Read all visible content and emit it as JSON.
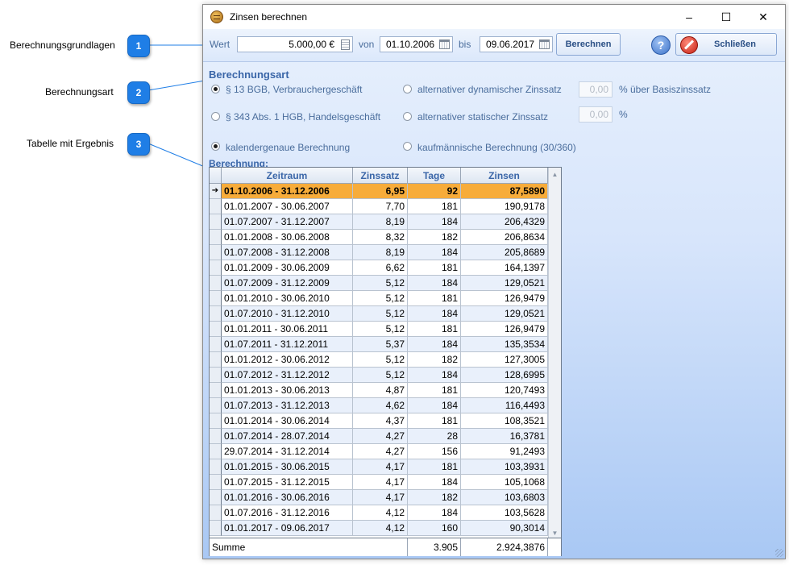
{
  "callouts": [
    {
      "number": "1",
      "label": "Berechnungsgrundlagen"
    },
    {
      "number": "2",
      "label": "Berechnungsart"
    },
    {
      "number": "3",
      "label": "Tabelle mit Ergebnis"
    }
  ],
  "window": {
    "title": "Zinsen berechnen",
    "minimize": "–",
    "maximize": "☐",
    "close": "✕"
  },
  "toolbar": {
    "wert_label": "Wert",
    "wert_value": "5.000,00 €",
    "von_label": "von",
    "von_value": "01.10.2006",
    "bis_label": "bis",
    "bis_value": "09.06.2017",
    "berechnen_label": "Berechnen",
    "help_label": "?",
    "schliessen_label": "Schließen"
  },
  "berechnungsart": {
    "title": "Berechnungsart",
    "options": [
      {
        "label": "§ 13 BGB, Verbrauchergeschäft",
        "checked": true
      },
      {
        "label": "§ 343 Abs. 1 HGB, Handelsgeschäft",
        "checked": false
      },
      {
        "label": "alternativer dynamischer Zinssatz",
        "checked": false
      },
      {
        "label": "alternativer statischer Zinssatz",
        "checked": false
      }
    ],
    "dyn_value": "0,00",
    "dyn_unit": "% über Basiszinssatz",
    "stat_value": "0,00",
    "stat_unit": "%",
    "method_options": [
      {
        "label": "kalendergenaue Berechnung",
        "checked": true
      },
      {
        "label": "kaufmännische Berechnung (30/360)",
        "checked": false
      }
    ]
  },
  "table": {
    "title": "Berechnung:",
    "columns": [
      "Zeitraum",
      "Zinssatz",
      "Tage",
      "Zinsen"
    ],
    "rows": [
      [
        "01.10.2006 - 31.12.2006",
        "6,95",
        "92",
        "87,5890"
      ],
      [
        "01.01.2007 - 30.06.2007",
        "7,70",
        "181",
        "190,9178"
      ],
      [
        "01.07.2007 - 31.12.2007",
        "8,19",
        "184",
        "206,4329"
      ],
      [
        "01.01.2008 - 30.06.2008",
        "8,32",
        "182",
        "206,8634"
      ],
      [
        "01.07.2008 - 31.12.2008",
        "8,19",
        "184",
        "205,8689"
      ],
      [
        "01.01.2009 - 30.06.2009",
        "6,62",
        "181",
        "164,1397"
      ],
      [
        "01.07.2009 - 31.12.2009",
        "5,12",
        "184",
        "129,0521"
      ],
      [
        "01.01.2010 - 30.06.2010",
        "5,12",
        "181",
        "126,9479"
      ],
      [
        "01.07.2010 - 31.12.2010",
        "5,12",
        "184",
        "129,0521"
      ],
      [
        "01.01.2011 - 30.06.2011",
        "5,12",
        "181",
        "126,9479"
      ],
      [
        "01.07.2011 - 31.12.2011",
        "5,37",
        "184",
        "135,3534"
      ],
      [
        "01.01.2012 - 30.06.2012",
        "5,12",
        "182",
        "127,3005"
      ],
      [
        "01.07.2012 - 31.12.2012",
        "5,12",
        "184",
        "128,6995"
      ],
      [
        "01.01.2013 - 30.06.2013",
        "4,87",
        "181",
        "120,7493"
      ],
      [
        "01.07.2013 - 31.12.2013",
        "4,62",
        "184",
        "116,4493"
      ],
      [
        "01.01.2014 - 30.06.2014",
        "4,37",
        "181",
        "108,3521"
      ],
      [
        "01.07.2014 - 28.07.2014",
        "4,27",
        "28",
        "16,3781"
      ],
      [
        "29.07.2014 - 31.12.2014",
        "4,27",
        "156",
        "91,2493"
      ],
      [
        "01.01.2015 - 30.06.2015",
        "4,17",
        "181",
        "103,3931"
      ],
      [
        "01.07.2015 - 31.12.2015",
        "4,17",
        "184",
        "105,1068"
      ],
      [
        "01.01.2016 - 30.06.2016",
        "4,17",
        "182",
        "103,6803"
      ],
      [
        "01.07.2016 - 31.12.2016",
        "4,12",
        "184",
        "103,5628"
      ],
      [
        "01.01.2017 - 09.06.2017",
        "4,12",
        "160",
        "90,3014"
      ]
    ],
    "summe_label": "Summe",
    "summe_tage": "3.905",
    "summe_zinsen": "2.924,3876"
  },
  "colors": {
    "selected_row": "#f7ac3a",
    "callout_badge": "#1f7ee6",
    "label_blue": "#4a6d9c"
  }
}
